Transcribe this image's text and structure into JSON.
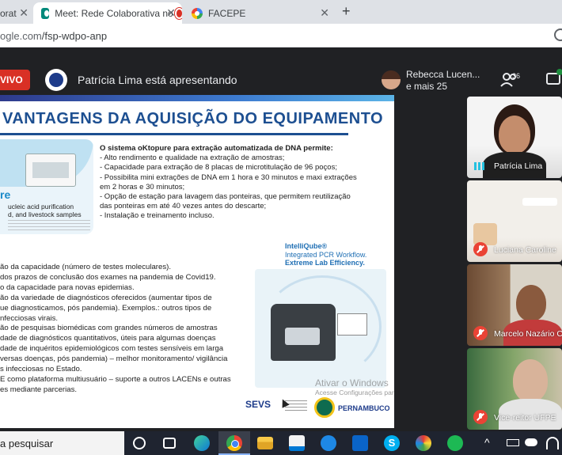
{
  "browser": {
    "tabs": [
      {
        "label": "orat",
        "active": false
      },
      {
        "label": "Meet: Rede Colaborativa no ",
        "active": true,
        "recording": true
      },
      {
        "label": "FACEPE",
        "active": false
      }
    ],
    "close_glyph": "✕",
    "new_tab_glyph": "+",
    "url_prefix": "ogle.com",
    "url_path": "/fsp-wdpo-anp"
  },
  "meet": {
    "live_label": "VIVO",
    "presenter_banner": "Patrícia Lima está apresentando",
    "participant_name": "Rebecca Lucen...",
    "participant_more": "e mais 25",
    "people_count": "36",
    "icons": [
      "people-icon",
      "chat-icon",
      "mic-off-icon",
      "speaking-indicator-icon"
    ],
    "tiles": [
      {
        "name": "Patrícia Lima",
        "muted": false
      },
      {
        "name": "Luciana Caroline",
        "muted": true
      },
      {
        "name": "Marcelo Nazário C",
        "muted": true
      },
      {
        "name": "Vice-reitor UFPE",
        "muted": true
      }
    ]
  },
  "slide": {
    "title": "VANTAGENS DA AQUISIÇÃO DO EQUIPAMENTO",
    "card": {
      "brand": "re",
      "line1": "ucleic acid purification",
      "line2": "d, and livestock samples"
    },
    "benefits_heading": "O sistema oKtopure para extração automatizada de DNA permite:",
    "benefits": [
      "- Alto rendimento e qualidade na extração de amostras;",
      "- Capacidade para extração de 8 placas de microtitulação de 96 poços;",
      "- Possibilita mini extrações de DNA em 1 hora e 30 minutos e maxi extrações",
      "em 2 horas e 30 minutos;",
      "- Opção de estação para lavagem das ponteiras, que permitem reutilização",
      "das ponteiras em até 40 vezes antes do descarte;",
      "- Instalação e treinamento incluso."
    ],
    "lower_lines": [
      "ão da capacidade (número de testes moleculares).",
      " dos prazos de conclusão dos exames na pandemia de Covid19.",
      "o da capacidade para novas epidemias.",
      "ão da variedade de diagnósticos oferecidos (aumentar tipos de",
      "ue diagnosticamos, pós pandemia). Exemplos.: outros tipos de",
      "nfecciosas virais.",
      "ão de pesquisas biomédicas com grandes números de amostras",
      "dade de diagnósticos quantitativos, úteis para algumas doenças",
      "dade de inquéritos epidemiológicos com testes sensíveis em larga",
      "versas doenças, pós pandemia) – melhor monitoramento/ vigilância",
      "s infecciosas no Estado.",
      "E como plataforma multiusuário – suporte a outros LACENs e outras",
      "es mediante parcerias."
    ],
    "intelli_brand": "IntelliQube®",
    "intelli_line1": "Integrated PCR Workflow.",
    "intelli_line2": "Extreme Lab Efficiency.",
    "sevs_label": "SEVS",
    "pe_label": "PERNAMBUCO",
    "watermark_title": "Ativar o Windows",
    "watermark_sub": "Acesse Configurações para ativar o Windows."
  },
  "taskbar": {
    "search_label": "a pesquisar",
    "apps": [
      "cortana-icon",
      "task-view-icon",
      "edge-icon",
      "chrome-icon",
      "file-explorer-icon",
      "store-icon",
      "chromium-icon",
      "mail-icon",
      "skype-icon",
      "paint-icon",
      "spotify-icon"
    ],
    "skype_glyph": "S",
    "tray_chevron": "^"
  },
  "colors": {
    "live_red": "#d93025",
    "meet_dark": "#202124",
    "slide_title_blue": "#1d4f91",
    "taskbar": "#1f2430"
  }
}
